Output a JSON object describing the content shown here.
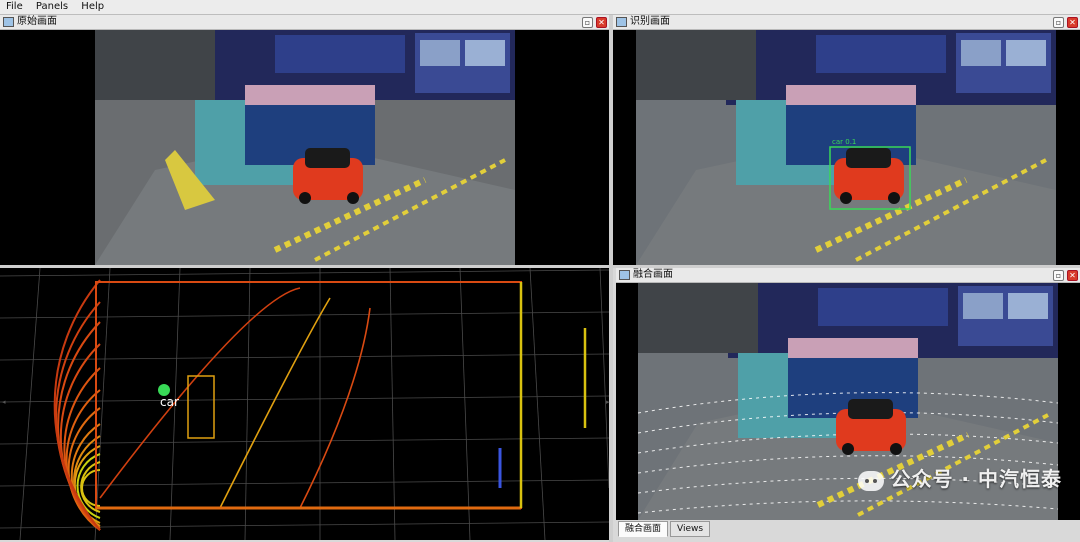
{
  "menu": {
    "file": "File",
    "panels": "Panels",
    "help": "Help"
  },
  "panels": {
    "raw": {
      "title": "原始画面"
    },
    "detect": {
      "title": "识别画面",
      "detection_label": "car 0.1"
    },
    "lidar": {
      "object_label": "car"
    },
    "fusion": {
      "title": "融合画面"
    }
  },
  "bottom_tabs": [
    "融合画面",
    "Views"
  ],
  "window_buttons": {
    "float": "▫",
    "close": "✕"
  },
  "watermark": "公众号 · 中汽恒泰",
  "colors": {
    "table_blue": "#1e3f7e",
    "car_red": "#e03a1e",
    "bbox_green": "#38d957",
    "lidar_orange": "#e06a10",
    "lidar_yellow": "#d9c210"
  }
}
